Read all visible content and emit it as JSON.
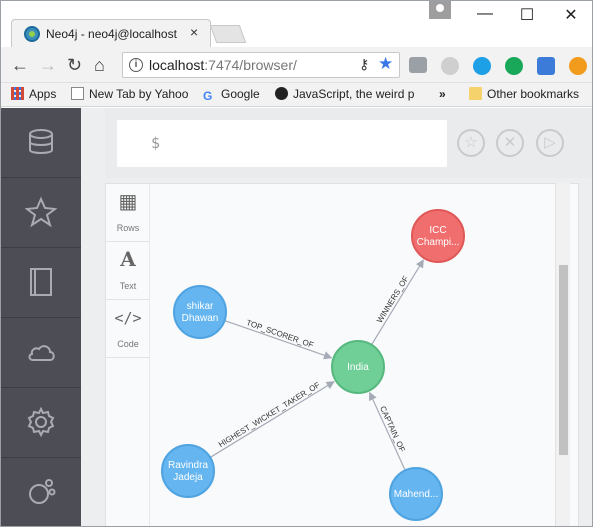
{
  "browser": {
    "tab_title": "Neo4j - neo4j@localhost",
    "tab_close": "×",
    "window_controls": {
      "minimize": "—",
      "maximize": "☐",
      "close": "✕"
    },
    "url_host": "localhost",
    "url_path": ":7474/browser/",
    "bookmarks": [
      {
        "label": "Apps",
        "icon": "apps-grid-icon"
      },
      {
        "label": "New Tab by Yahoo",
        "icon": "yahoo-icon"
      },
      {
        "label": "Google",
        "icon": "google-icon"
      },
      {
        "label": "JavaScript, the weird p",
        "icon": "github-icon"
      }
    ],
    "bookmarks_overflow": "»",
    "other_bookmarks": "Other bookmarks"
  },
  "sidebar": {
    "items": [
      {
        "icon": "database-icon"
      },
      {
        "icon": "star-icon"
      },
      {
        "icon": "book-icon"
      },
      {
        "icon": "cloud-icon"
      },
      {
        "icon": "gear-icon"
      },
      {
        "icon": "neo4j-logo-icon"
      }
    ]
  },
  "editor": {
    "prompt": "$",
    "actions": [
      {
        "icon": "star-icon",
        "glyph": "☆"
      },
      {
        "icon": "close-icon",
        "glyph": "✕"
      },
      {
        "icon": "play-icon",
        "glyph": "▷"
      }
    ]
  },
  "result_tabs": [
    {
      "label": "Rows",
      "glyph": "▦"
    },
    {
      "label": "Text",
      "glyph": "A"
    },
    {
      "label": "Code",
      "glyph": "</>"
    }
  ],
  "graph": {
    "nodes": [
      {
        "id": "icc",
        "label_lines": [
          "ICC",
          "Champi..."
        ],
        "color": "#f06e6e",
        "stroke": "#e05757"
      },
      {
        "id": "shikar",
        "label_lines": [
          "shikar",
          "Dhawan"
        ],
        "color": "#64b5f0",
        "stroke": "#4ea3e0"
      },
      {
        "id": "india",
        "label_lines": [
          "India"
        ],
        "color": "#6fcf97",
        "stroke": "#57b87f"
      },
      {
        "id": "ravindra",
        "label_lines": [
          "Ravindra",
          "Jadeja"
        ],
        "color": "#64b5f0",
        "stroke": "#4ea3e0"
      },
      {
        "id": "mahend",
        "label_lines": [
          "Mahend..."
        ],
        "color": "#64b5f0",
        "stroke": "#4ea3e0"
      }
    ],
    "relationships": [
      {
        "from": "shikar",
        "to": "india",
        "type": "TOP_SCORER_OF"
      },
      {
        "from": "india",
        "to": "icc",
        "type": "WINNERS_OF"
      },
      {
        "from": "ravindra",
        "to": "india",
        "type": "HIGHEST_WICKET_TAKER_OF"
      },
      {
        "from": "mahend",
        "to": "india",
        "type": "CAPTAIN_OF"
      }
    ]
  }
}
